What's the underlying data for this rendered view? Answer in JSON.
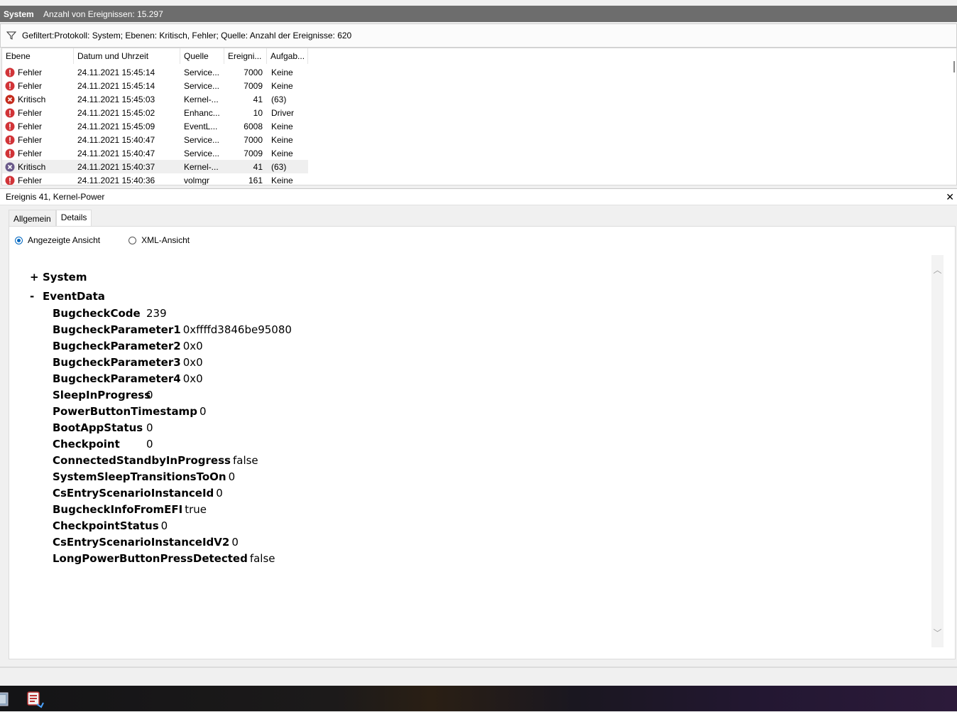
{
  "window": {
    "log_name": "System",
    "event_count": "Anzahl von Ereignissen: 15.297"
  },
  "filter": {
    "text": "Gefiltert:Protokoll: System; Ebenen: Kritisch, Fehler; Quelle:  Anzahl der Ereignisse: 620"
  },
  "table": {
    "columns": [
      "Ebene",
      "Datum und Uhrzeit",
      "Quelle",
      "Ereigni...",
      "Aufgab..."
    ],
    "rows": [
      {
        "level": "Fehler",
        "type": "error",
        "date": "24.11.2021 15:45:14",
        "source": "Service...",
        "id": "7000",
        "task": "Keine"
      },
      {
        "level": "Fehler",
        "type": "error",
        "date": "24.11.2021 15:45:14",
        "source": "Service...",
        "id": "7009",
        "task": "Keine"
      },
      {
        "level": "Kritisch",
        "type": "critical",
        "date": "24.11.2021 15:45:03",
        "source": "Kernel-...",
        "id": "41",
        "task": "(63)"
      },
      {
        "level": "Fehler",
        "type": "error",
        "date": "24.11.2021 15:45:02",
        "source": "Enhanc...",
        "id": "10",
        "task": "Driver"
      },
      {
        "level": "Fehler",
        "type": "error",
        "date": "24.11.2021 15:45:09",
        "source": "EventL...",
        "id": "6008",
        "task": "Keine"
      },
      {
        "level": "Fehler",
        "type": "error",
        "date": "24.11.2021 15:40:47",
        "source": "Service...",
        "id": "7000",
        "task": "Keine"
      },
      {
        "level": "Fehler",
        "type": "error",
        "date": "24.11.2021 15:40:47",
        "source": "Service...",
        "id": "7009",
        "task": "Keine"
      },
      {
        "level": "Kritisch",
        "type": "critical-selected",
        "date": "24.11.2021 15:40:37",
        "source": "Kernel-...",
        "id": "41",
        "task": "(63)"
      },
      {
        "level": "Fehler",
        "type": "error",
        "date": "24.11.2021 15:40:36",
        "source": "volmgr",
        "id": "161",
        "task": "Keine"
      }
    ]
  },
  "detail": {
    "title": "Ereignis 41, Kernel-Power",
    "close_glyph": "✕",
    "tabs": [
      "Allgemein",
      "Details"
    ],
    "radio_friendly": "Angezeigte Ansicht",
    "radio_xml": "XML-Ansicht",
    "system_sign": "+",
    "system_label": "System",
    "eventdata_sign": "-",
    "eventdata_label": "EventData",
    "fields": [
      {
        "key": "BugcheckCode",
        "value": "239"
      },
      {
        "key": "BugcheckParameter1",
        "value": "0xffffd3846be95080"
      },
      {
        "key": "BugcheckParameter2",
        "value": "0x0"
      },
      {
        "key": "BugcheckParameter3",
        "value": "0x0"
      },
      {
        "key": "BugcheckParameter4",
        "value": "0x0"
      },
      {
        "key": "SleepInProgress",
        "value": "0"
      },
      {
        "key": "PowerButtonTimestamp",
        "value": "0"
      },
      {
        "key": "BootAppStatus",
        "value": "0"
      },
      {
        "key": "Checkpoint",
        "value": "0"
      },
      {
        "key": "ConnectedStandbyInProgress",
        "value": "false"
      },
      {
        "key": "SystemSleepTransitionsToOn",
        "value": "0"
      },
      {
        "key": "CsEntryScenarioInstanceId",
        "value": "0"
      },
      {
        "key": "BugcheckInfoFromEFI",
        "value": "true"
      },
      {
        "key": "CheckpointStatus",
        "value": "0"
      },
      {
        "key": "CsEntryScenarioInstanceIdV2",
        "value": "0"
      },
      {
        "key": "LongPowerButtonPressDetected",
        "value": "false"
      }
    ]
  },
  "colors": {
    "error": "#d13438",
    "critical": "#c42b1c",
    "selected_critical": "#6a5a8a",
    "accent": "#0067c0"
  },
  "taskbar": {
    "icons": [
      "app-icon",
      "event-viewer-icon"
    ]
  }
}
